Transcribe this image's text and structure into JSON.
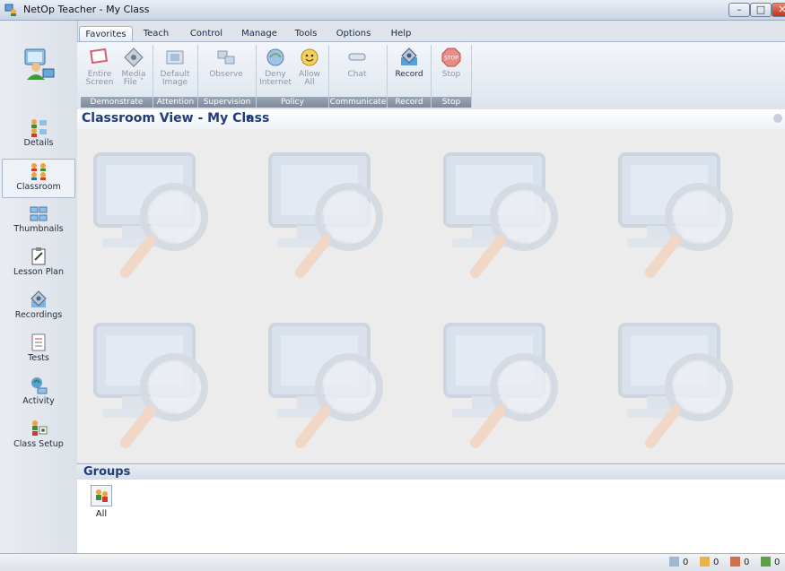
{
  "window": {
    "title": "NetOp Teacher - My Class",
    "min_glyph": "–",
    "max_glyph": "□",
    "close_glyph": "✕"
  },
  "sidebar": {
    "items": [
      {
        "label": "Details",
        "icon": "details-icon"
      },
      {
        "label": "Classroom",
        "icon": "classroom-icon",
        "active": true
      },
      {
        "label": "Thumbnails",
        "icon": "thumbnails-icon"
      },
      {
        "label": "Lesson Plan",
        "icon": "lesson-plan-icon"
      },
      {
        "label": "Recordings",
        "icon": "recordings-icon"
      },
      {
        "label": "Tests",
        "icon": "tests-icon"
      },
      {
        "label": "Activity",
        "icon": "activity-icon"
      },
      {
        "label": "Class Setup",
        "icon": "class-setup-icon"
      }
    ]
  },
  "ribbon": {
    "tabs": [
      "Favorites",
      "Teach",
      "Control",
      "Manage",
      "Tools",
      "Options",
      "Help"
    ],
    "active_tab": "Favorites",
    "groups": [
      {
        "title": "Demonstrate",
        "buttons": [
          {
            "label1": "Entire",
            "label2": "Screen"
          },
          {
            "label1": "Media",
            "label2": "File ˅"
          }
        ]
      },
      {
        "title": "Attention",
        "buttons": [
          {
            "label1": "Default",
            "label2": "Image"
          }
        ]
      },
      {
        "title": "Supervision",
        "buttons": [
          {
            "label1": "Observe",
            "label2": ""
          }
        ]
      },
      {
        "title": "Policy",
        "buttons": [
          {
            "label1": "Deny",
            "label2": "Internet"
          },
          {
            "label1": "Allow",
            "label2": "All"
          }
        ]
      },
      {
        "title": "Communicate",
        "buttons": [
          {
            "label1": "Chat",
            "label2": ""
          }
        ]
      },
      {
        "title": "Record",
        "buttons": [
          {
            "label1": "Record",
            "label2": ""
          }
        ]
      },
      {
        "title": "Stop",
        "buttons": [
          {
            "label1": "Stop",
            "label2": ""
          }
        ]
      }
    ],
    "stop_icon_text": "STOP"
  },
  "view": {
    "title": "Classroom View - My Class",
    "caret": "▾"
  },
  "groups": {
    "title": "Groups",
    "items": [
      {
        "label": "All"
      }
    ]
  },
  "status": {
    "counts": [
      "0",
      "0",
      "0",
      "0"
    ]
  },
  "colors": {
    "accent_title": "#1f3d7a",
    "ribbon_group_bar": "#8a95a6",
    "close_red": "#c2301a"
  }
}
